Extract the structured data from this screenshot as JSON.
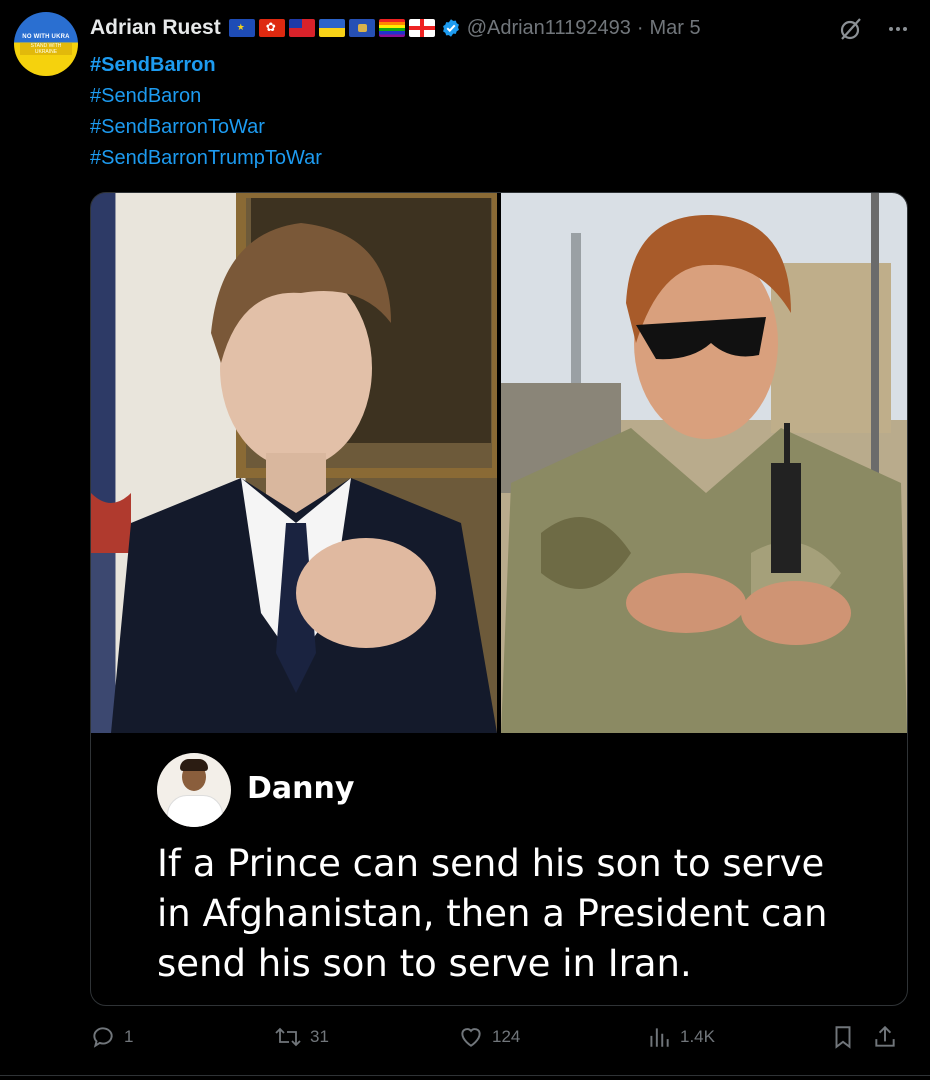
{
  "tweet": {
    "author": {
      "name": "Adrian Ruest",
      "handle": "@Adrian11192493",
      "date": "Mar 5",
      "separator": "·",
      "avatar_badge_text": "NO WITH UKRA",
      "avatar_badge_text2": "STAND WITH UKRAINE",
      "flags": [
        "eu",
        "hong-kong",
        "taiwan",
        "ukraine",
        "kosovo",
        "rainbow",
        "georgia"
      ],
      "verified": true
    },
    "hashtags": [
      "#SendBarron",
      "#SendBaron",
      "#SendBarronToWar",
      "#SendBarronTrumpToWar"
    ],
    "quote_card": {
      "name": "Danny",
      "text": "If a Prince can send his son to serve in Afghanistan, then a President can send his son to serve in Iran."
    },
    "actions": {
      "replies": "1",
      "reposts": "31",
      "likes": "124",
      "views": "1.4K"
    }
  },
  "colors": {
    "background": "#000000",
    "text": "#e7e9ea",
    "muted": "#71767b",
    "accent": "#1d9bf0",
    "border": "#2f3336"
  }
}
